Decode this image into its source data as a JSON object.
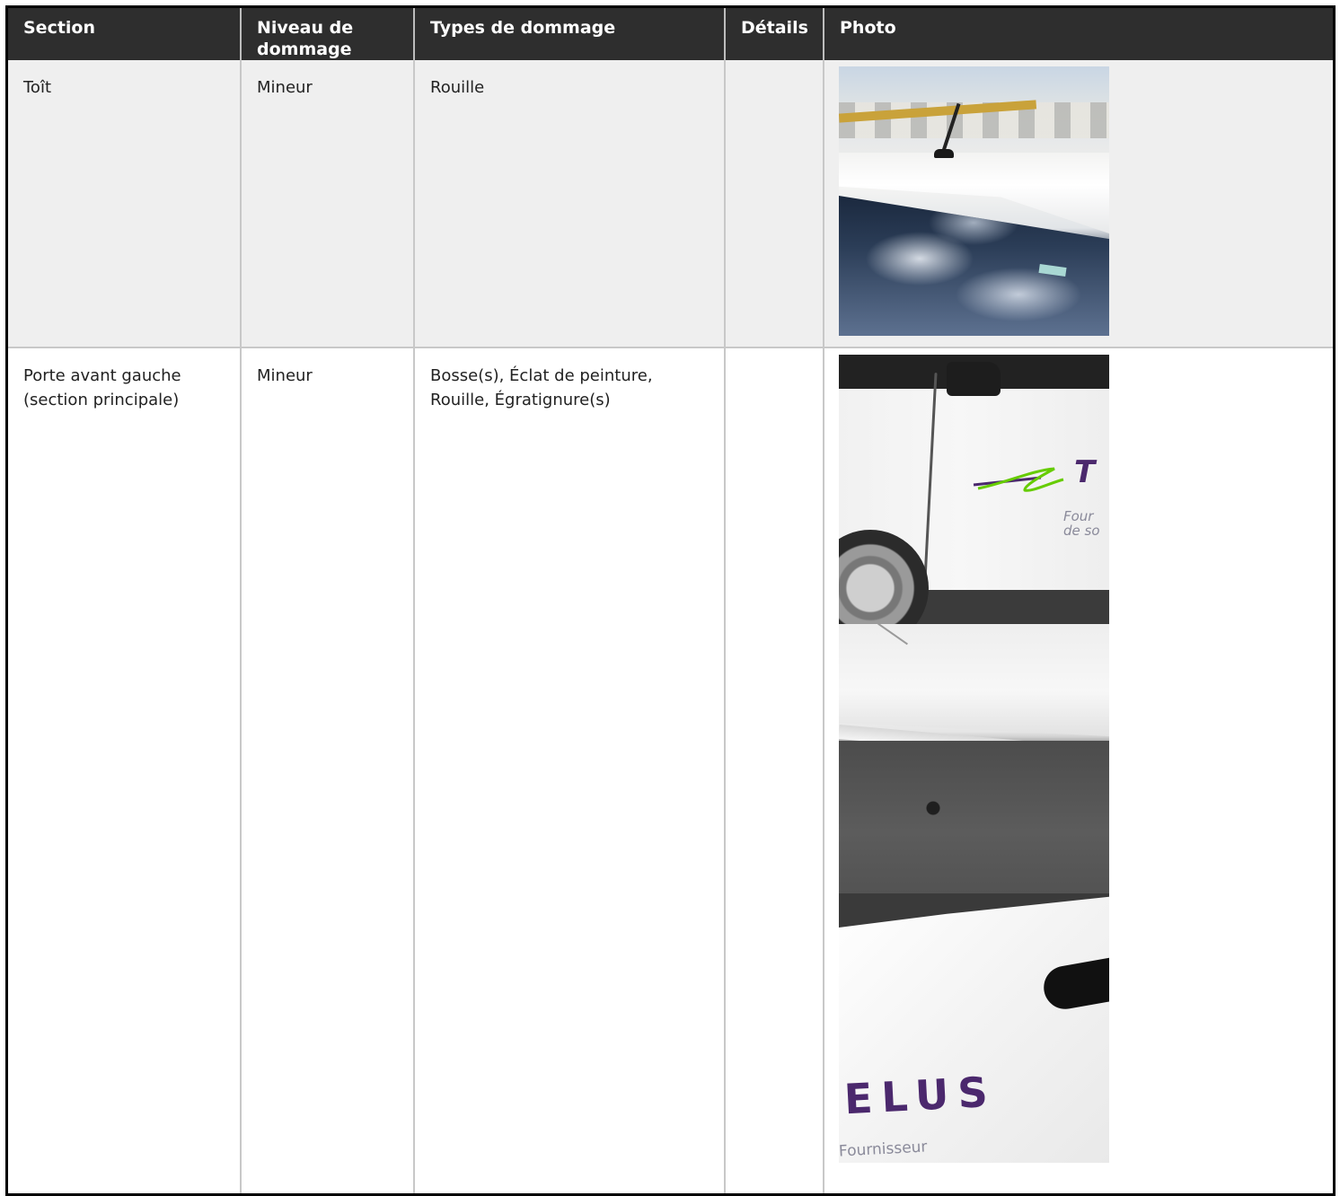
{
  "table": {
    "headers": {
      "section": "Section",
      "level": "Niveau de dommage",
      "types": "Types de dommage",
      "details": "Détails",
      "photo": "Photo"
    },
    "rows": [
      {
        "section": "Toît",
        "level": "Mineur",
        "types": "Rouille",
        "details": "",
        "photos": [
          "roof-rust-photo"
        ]
      },
      {
        "section": "Porte avant gauche (section principale)",
        "level": "Mineur",
        "types": "Bosse(s), Éclat de peinture, Rouille, Égratignure(s)",
        "details": "",
        "photos": [
          "door-front-photo",
          "door-sill-photo",
          "door-logo-photo"
        ]
      }
    ]
  },
  "photo_text": {
    "door1_brand": "T",
    "door1_tag_line1": "Four",
    "door1_tag_line2": "de so",
    "door3_brand": "ELUS",
    "door3_tagline": "Fournisseur"
  },
  "colors": {
    "header_bg": "#2e2e2e",
    "header_text": "#ffffff",
    "row_alt_bg": "#efefef",
    "brand_purple": "#4b286d",
    "brand_green": "#66cc00"
  }
}
